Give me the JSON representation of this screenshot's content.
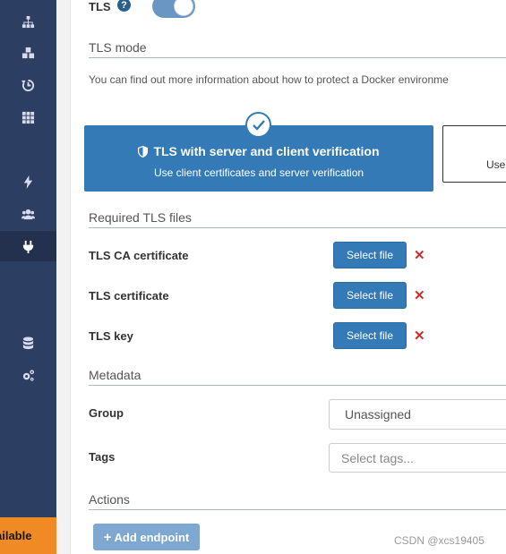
{
  "sidebar": {
    "icons": [
      "sitemap-icon",
      "cubes-icon",
      "history-icon",
      "th-icon",
      "bolt-icon",
      "users-icon",
      "plug-icon",
      "database-icon",
      "cogs-icon"
    ],
    "active_icon": "plug-icon",
    "update_banner": "ailable"
  },
  "tls": {
    "label": "TLS",
    "help": "?",
    "enabled": true
  },
  "tls_mode": {
    "section_title": "TLS mode",
    "info": "You can find out more information about how to protect a Docker environme",
    "selected_option": {
      "title": "TLS with server and client verification",
      "subtitle": "Use client certificates and server verification"
    },
    "other_option": {
      "subtitle": "Use"
    }
  },
  "required_files": {
    "section_title": "Required TLS files",
    "files": [
      {
        "label": "TLS CA certificate",
        "button": "Select file",
        "remove": "✕"
      },
      {
        "label": "TLS certificate",
        "button": "Select file",
        "remove": "✕"
      },
      {
        "label": "TLS key",
        "button": "Select file",
        "remove": "✕"
      }
    ]
  },
  "metadata": {
    "section_title": "Metadata",
    "group_label": "Group",
    "group_value": "Unassigned",
    "tags_label": "Tags",
    "tags_placeholder": "Select tags..."
  },
  "actions": {
    "section_title": "Actions",
    "add_button": "Add endpoint"
  },
  "watermark": "CSDN @xcs19405",
  "colors": {
    "sidebar": "#2d3e63",
    "primary": "#337ab7",
    "danger": "#c9302c",
    "warning": "#f08a24"
  }
}
